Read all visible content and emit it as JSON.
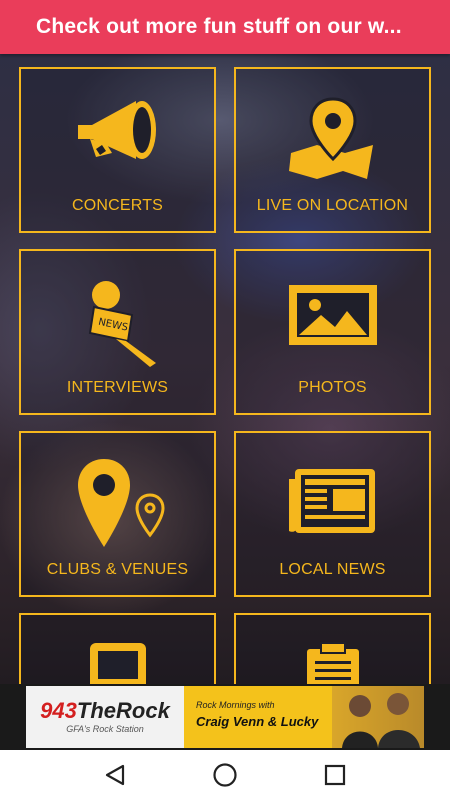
{
  "banner": {
    "text": "Check out more fun stuff on our w..."
  },
  "tiles": [
    {
      "label": "CONCERTS",
      "icon": "megaphone-icon"
    },
    {
      "label": "LIVE ON LOCATION",
      "icon": "map-pin-icon"
    },
    {
      "label": "INTERVIEWS",
      "icon": "news-microphone-icon"
    },
    {
      "label": "PHOTOS",
      "icon": "photo-icon"
    },
    {
      "label": "CLUBS & VENUES",
      "icon": "location-pins-icon"
    },
    {
      "label": "LOCAL NEWS",
      "icon": "newspaper-icon"
    },
    {
      "label": "",
      "icon": "tablet-icon"
    },
    {
      "label": "",
      "icon": "clipboard-icon"
    }
  ],
  "ad": {
    "logo_number": "943",
    "logo_name": "TheRock",
    "logo_tagline": "GFA's Rock Station",
    "line1": "Rock Mornings with",
    "line2": "Craig Venn & Lucky"
  },
  "nav": {
    "back": "back-icon",
    "home": "home-icon",
    "recents": "recents-icon"
  },
  "colors": {
    "accent": "#f5b71d",
    "banner": "#ea3d5a"
  }
}
